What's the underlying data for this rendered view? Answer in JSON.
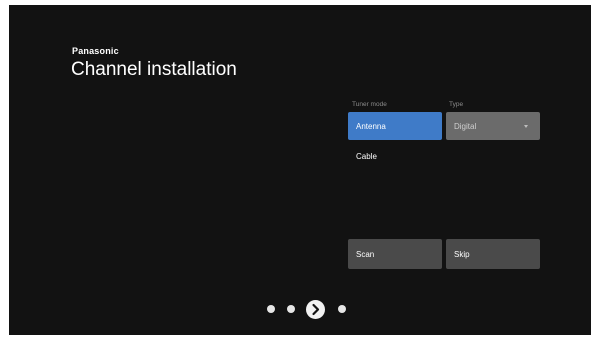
{
  "header": {
    "brand": "Panasonic",
    "title": "Channel installation"
  },
  "tuner_mode": {
    "label": "Tuner mode",
    "options": [
      "Antenna",
      "Cable"
    ],
    "selected": "Antenna"
  },
  "type": {
    "label": "Type",
    "value": "Digital"
  },
  "actions": {
    "scan_label": "Scan",
    "skip_label": "Skip"
  },
  "pager": {
    "total_steps": 4,
    "current_step": 3
  },
  "colors": {
    "background": "#121212",
    "selected_option": "#3f7bc8",
    "button": "#4a4a4a",
    "select_box": "#6b6b6b"
  },
  "icons": {
    "current_step": "chevron-right-icon",
    "type_dropdown": "caret-down-icon"
  }
}
